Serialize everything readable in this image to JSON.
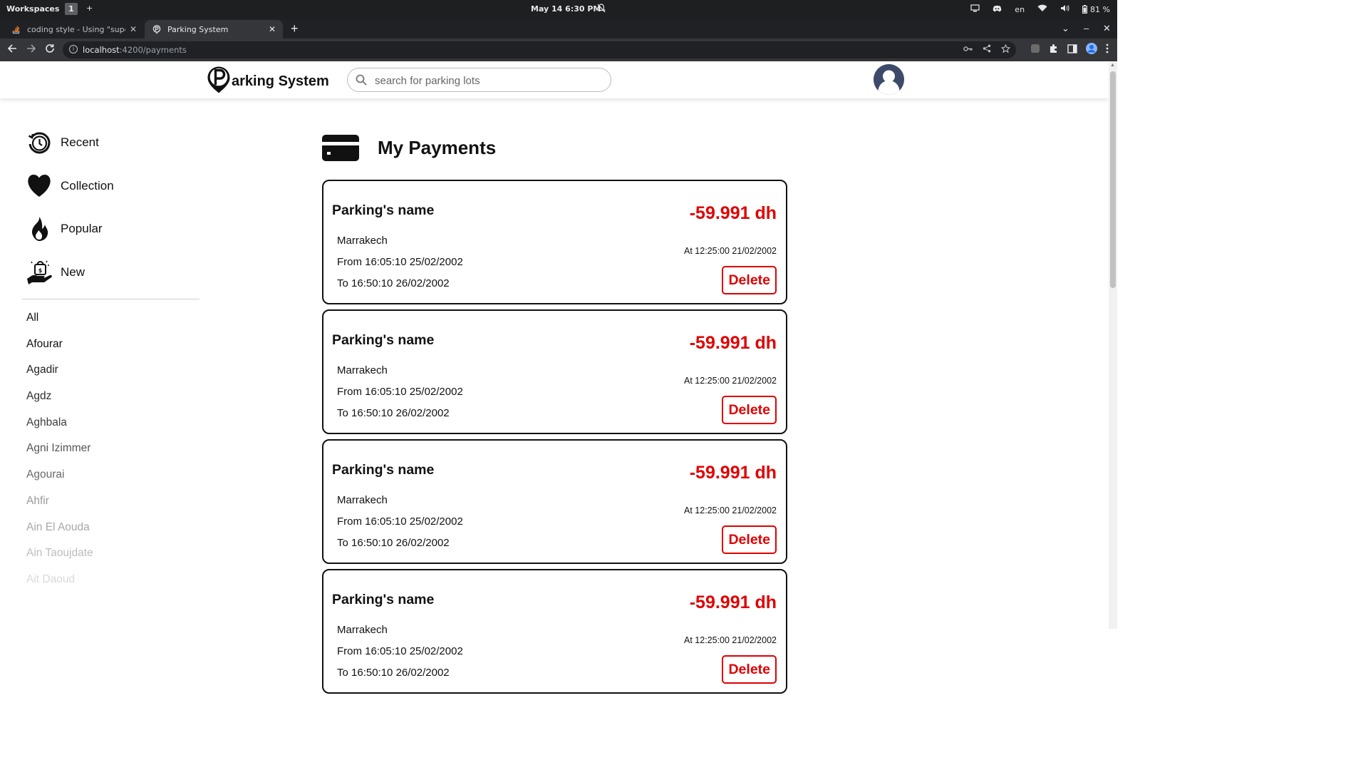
{
  "os": {
    "workspaces_label": "Workspaces",
    "workspace_number": "1",
    "workspace_add": "+",
    "clock": "May 14   6:30 PM",
    "language": "en",
    "battery": "81 %"
  },
  "browser": {
    "tabs": [
      {
        "title": "coding style - Using \"super\" in",
        "icon": "stackoverflow-icon",
        "active": false
      },
      {
        "title": "Parking System",
        "icon": "parking-favicon",
        "active": true
      }
    ],
    "url_host": "localhost",
    "url_rest": ":4200/payments"
  },
  "header": {
    "brand_rest": "arking System",
    "search_placeholder": "search for parking lots"
  },
  "sidebar": {
    "nav": [
      {
        "label": "Recent",
        "icon": "recent-clock-icon"
      },
      {
        "label": "Collection",
        "icon": "heart-icon"
      },
      {
        "label": "Popular",
        "icon": "fire-icon"
      },
      {
        "label": "New",
        "icon": "new-hand-bag-icon"
      }
    ],
    "cities": [
      {
        "label": "All",
        "color": "#111111"
      },
      {
        "label": "Afourar",
        "color": "#111111"
      },
      {
        "label": "Agadir",
        "color": "#222222"
      },
      {
        "label": "Agdz",
        "color": "#2e2e2e"
      },
      {
        "label": "Aghbala",
        "color": "#3d3d3d"
      },
      {
        "label": "Agni Izimmer",
        "color": "#555555"
      },
      {
        "label": "Agourai",
        "color": "#6a6a6a"
      },
      {
        "label": "Ahfir",
        "color": "#9a9a9a"
      },
      {
        "label": "Ain El Aouda",
        "color": "#a8a8a8"
      },
      {
        "label": "Ain Taoujdate",
        "color": "#bdbdbd"
      },
      {
        "label": "Ait Daoud",
        "color": "#d9d9d9"
      }
    ]
  },
  "main": {
    "title": "My Payments",
    "payments": [
      {
        "name": "Parking's name",
        "amount": "-59.991 dh",
        "city": "Marrakech",
        "from": "From 16:05:10 25/02/2002",
        "to": "To 16:50:10 26/02/2002",
        "at": "At 12:25:00 21/02/2002",
        "delete_label": "Delete"
      },
      {
        "name": "Parking's name",
        "amount": "-59.991 dh",
        "city": "Marrakech",
        "from": "From 16:05:10 25/02/2002",
        "to": "To 16:50:10 26/02/2002",
        "at": "At 12:25:00 21/02/2002",
        "delete_label": "Delete"
      },
      {
        "name": "Parking's name",
        "amount": "-59.991 dh",
        "city": "Marrakech",
        "from": "From 16:05:10 25/02/2002",
        "to": "To 16:50:10 26/02/2002",
        "at": "At 12:25:00 21/02/2002",
        "delete_label": "Delete"
      },
      {
        "name": "Parking's name",
        "amount": "-59.991 dh",
        "city": "Marrakech",
        "from": "From 16:05:10 25/02/2002",
        "to": "To 16:50:10 26/02/2002",
        "at": "At 12:25:00 21/02/2002",
        "delete_label": "Delete"
      }
    ]
  },
  "colors": {
    "amount": "#e00000",
    "delete": "#e00000",
    "text": "#111111",
    "avatar": "#3e4a6a"
  }
}
